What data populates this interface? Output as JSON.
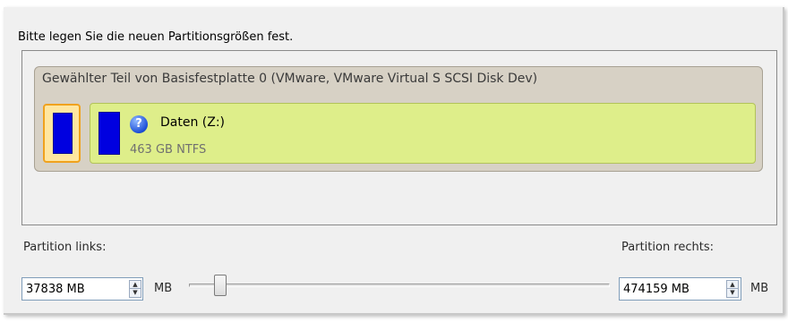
{
  "instruction": "Bitte legen Sie die neuen Partitionsgrößen fest.",
  "disk": {
    "title": "Gewählter Teil von Basisfestplatte 0 (VMware, VMware Virtual S SCSI Disk Dev)",
    "partition": {
      "name": "Daten (Z:)",
      "info": "463 GB NTFS",
      "icon": "question-icon"
    }
  },
  "left": {
    "label": "Partition links:",
    "value": "37838 MB",
    "unit": "MB"
  },
  "right": {
    "label": "Partition rechts:",
    "value": "474159 MB",
    "unit": "MB"
  },
  "slider": {
    "fraction": 0.074
  },
  "colors": {
    "partition_bar": "#0000e0",
    "partition_fill": "#deee8a",
    "unallocated_border": "#f0a21e",
    "disk_frame": "#d7d1c5"
  }
}
